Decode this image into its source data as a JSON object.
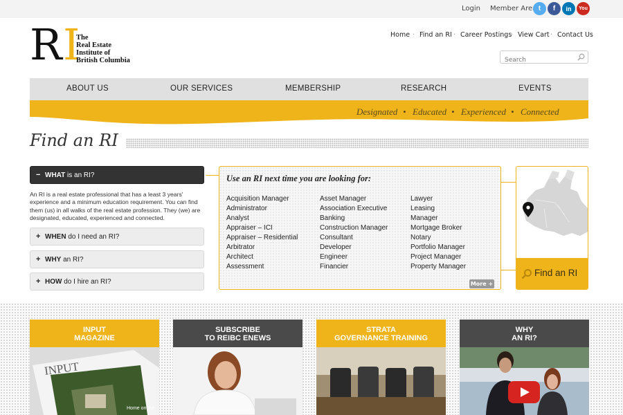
{
  "topbar": {
    "login": "Login",
    "member_area": "Member Area",
    "social": [
      {
        "name": "twitter",
        "glyph": "t",
        "color": "#55acee"
      },
      {
        "name": "facebook",
        "glyph": "f",
        "color": "#3b5998"
      },
      {
        "name": "linkedin",
        "glyph": "in",
        "color": "#0077b5"
      },
      {
        "name": "youtube",
        "glyph": "You",
        "color": "#cc2a1f"
      }
    ]
  },
  "logo": {
    "mark_r": "R",
    "mark_i": "I",
    "line1": "The",
    "line2": "Real Estate",
    "line3": "Institute of",
    "line4": "British Columbia"
  },
  "util_nav": [
    "Home",
    "Find an RI",
    "Career Postings",
    "View Cart",
    "Contact Us"
  ],
  "search": {
    "placeholder": "Search"
  },
  "main_nav": [
    "ABOUT US",
    "OUR SERVICES",
    "MEMBERSHIP",
    "RESEARCH",
    "EVENTS"
  ],
  "banner": {
    "tags": [
      "Designated",
      "Educated",
      "Experienced",
      "Connected"
    ],
    "separator": "•"
  },
  "page_title": "Find an RI",
  "accordion": [
    {
      "sign": "−",
      "bold": "WHAT",
      "rest": " is an RI?"
    },
    {
      "sign": "+",
      "bold": "WHEN",
      "rest": " do I need an RI?"
    },
    {
      "sign": "+",
      "bold": "WHY",
      "rest": " an RI?"
    },
    {
      "sign": "+",
      "bold": "HOW",
      "rest": " do I hire an RI?"
    }
  ],
  "what_text": "An RI is a real estate professional that has a least 3 years' experience and a minimum education requirement. You can find them (us) in all walks of the real estate profession. They (we) are designated, educated, experienced and connected.",
  "use_box": {
    "title": "Use an RI next time you are looking for:",
    "col1": [
      "Acquisition Manager",
      "Administrator",
      "Analyst",
      "Appraiser – ICI",
      "Appraiser – Residential",
      "Arbitrator",
      "Architect",
      "Assessment"
    ],
    "col2": [
      "Asset Manager",
      "Association Executive",
      "Banking",
      "Construction Manager",
      "Consultant",
      "Developer",
      "Engineer",
      "Financier"
    ],
    "col3": [
      "Lawyer",
      "Leasing",
      "Manager",
      "Mortgage Broker",
      "Notary",
      "Portfolio Manager",
      "Project Manager",
      "Property Manager"
    ],
    "more": "More +"
  },
  "find_box": {
    "label": "Find an RI"
  },
  "cards": [
    {
      "line1": "INPUT",
      "line2": "MAGAZINE",
      "color": "#f0b41b"
    },
    {
      "line1": "SUBSCRIBE",
      "line2": "TO REIBC ENEWS",
      "color": "#4a4a4a"
    },
    {
      "line1": "STRATA",
      "line2": "GOVERNANCE TRAINING",
      "color": "#f0b41b"
    },
    {
      "line1": "WHY",
      "line2": "AN RI?",
      "color": "#4a4a4a"
    }
  ],
  "magazine_cover": {
    "title": "INPUT",
    "caption": "Home on the"
  }
}
